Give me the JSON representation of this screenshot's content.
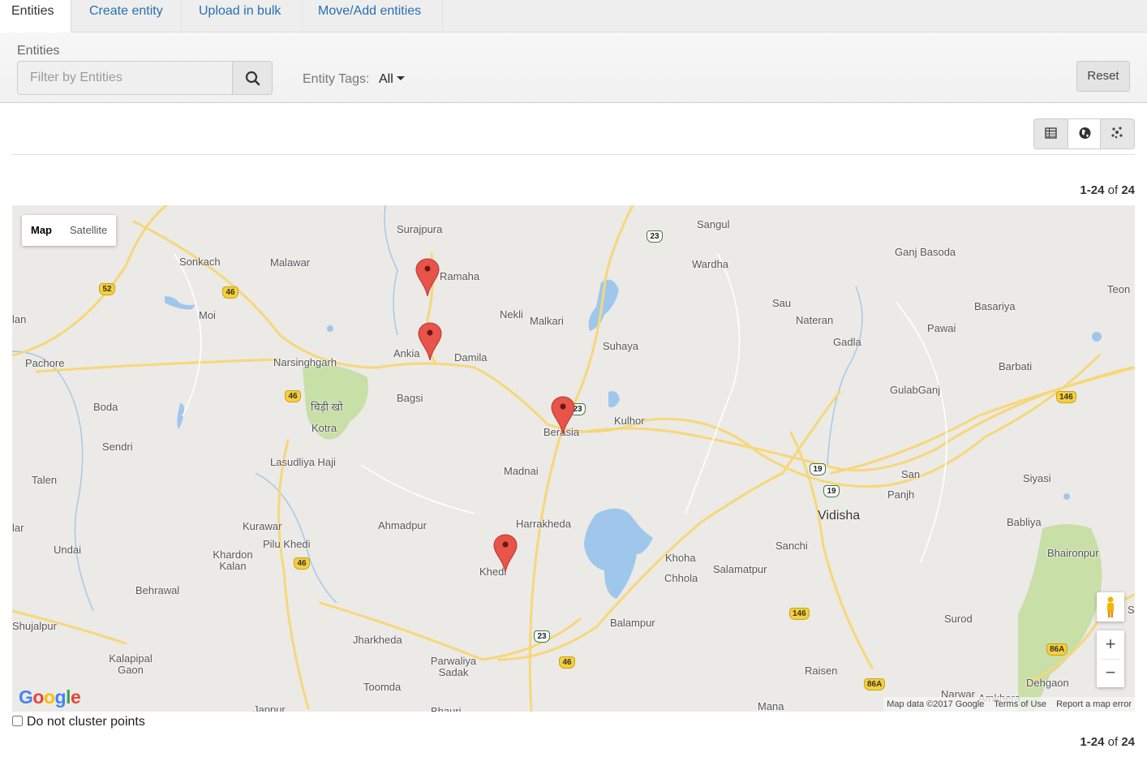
{
  "tabs": [
    {
      "label": "Entities",
      "active": true
    },
    {
      "label": "Create entity",
      "active": false
    },
    {
      "label": "Upload in bulk",
      "active": false
    },
    {
      "label": "Move/Add entities",
      "active": false
    }
  ],
  "filter": {
    "label": "Entities",
    "placeholder": "Filter by Entities",
    "search_icon": "search-icon",
    "tags_label": "Entity Tags:",
    "tags_value": "All",
    "reset_label": "Reset"
  },
  "view_toggle": {
    "options": [
      "table-icon",
      "globe-icon",
      "scatter-icon"
    ],
    "selected": "globe-icon"
  },
  "pagination": {
    "start": "1-24",
    "of_label": "of",
    "total": "24"
  },
  "map": {
    "type_options": [
      "Map",
      "Satellite"
    ],
    "selected_type": "Map",
    "places": [
      "Surajpura",
      "Sangul",
      "Sonkach",
      "Malawar",
      "Ramaha",
      "Wardha",
      "Ganj Basoda",
      "Teon",
      "Moi",
      "Sau",
      "Basariya",
      "lan",
      "Nekli",
      "Malkari",
      "Nateran",
      "Pawai",
      "Ankia",
      "Damila",
      "Gadla",
      "Pachore",
      "Narsinghgarh",
      "Suhaya",
      "Barbati",
      "GulabGanj",
      "Bagsi",
      "Boda",
      "चिड़ी खो",
      "Kulhor",
      "Kotra",
      "Berasia",
      "Sendri",
      "Lasudliya Haji",
      "Madnai",
      "San",
      "Siyasi",
      "Talen",
      "Panjh",
      "Vidisha",
      "Harrakheda",
      "lar",
      "Kurawar",
      "Ahmadpur",
      "Babliya",
      "Pilu Khedi",
      "Sanchi",
      "Undai",
      "Khardon Kalan",
      "Khoha",
      "Bhaironpur",
      "Khedi",
      "Salamatpur",
      "Chhola",
      "Behrawal",
      "Surod",
      "Balampur",
      "Sa",
      "Shujalpur",
      "Jharkheda",
      "Kalapipal Gaon",
      "Raisen",
      "Parwaliya Sadak",
      "Dehgaon",
      "Toomda",
      "Narwar",
      "Amkhera",
      "Mana",
      "Jappur",
      "Bhauri"
    ],
    "highway_shields": [
      "23",
      "52",
      "46",
      "46",
      "23",
      "146",
      "19",
      "19",
      "46",
      "146",
      "23",
      "46",
      "86A",
      "86A"
    ],
    "markers": [
      "Ramaha",
      "Ankia",
      "Berasia",
      "Khedi"
    ],
    "attribution": "Map data ©2017 Google",
    "terms_label": "Terms of Use",
    "report_label": "Report a map error",
    "logo_text": "Google",
    "zoom_in_label": "+",
    "zoom_out_label": "−"
  },
  "cluster_checkbox": {
    "label": "Do not cluster points",
    "checked": false
  },
  "colors": {
    "link": "#2a6fb0",
    "marker": "#e8534a",
    "road": "#f6d77a",
    "forest": "#c8dfa8",
    "water": "#9fc7ec"
  }
}
